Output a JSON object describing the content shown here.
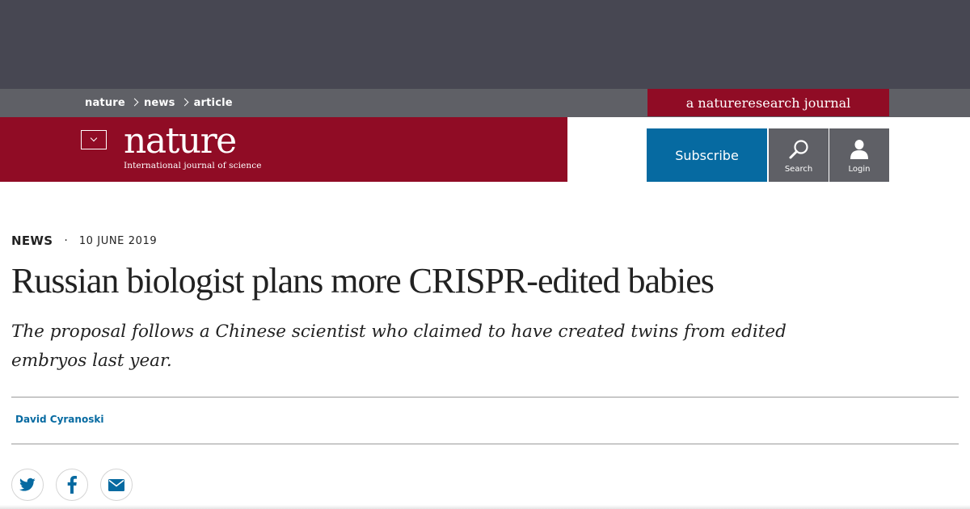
{
  "breadcrumb": {
    "items": [
      "nature",
      "news",
      "article"
    ]
  },
  "banner": {
    "prefix": "a",
    "brand": "natureresearch",
    "suffix": "journal"
  },
  "logo": {
    "wordmark": "nature",
    "tagline": "International journal of science"
  },
  "actions": {
    "subscribe": "Subscribe",
    "search": "Search",
    "login": "Login"
  },
  "article": {
    "type": "NEWS",
    "separator": "·",
    "date": "10 JUNE 2019",
    "title": "Russian biologist plans more CRISPR-edited babies",
    "standfirst": "The proposal follows a Chinese scientist who claimed to have created twins from edited embryos last year.",
    "author": "David Cyranoski"
  },
  "share": {
    "icons": [
      "twitter-icon",
      "facebook-icon",
      "email-icon"
    ]
  },
  "colors": {
    "brand_red": "#900c25",
    "link_blue": "#066aa1",
    "dark_gray": "#474752",
    "mid_gray": "#5f6066"
  }
}
